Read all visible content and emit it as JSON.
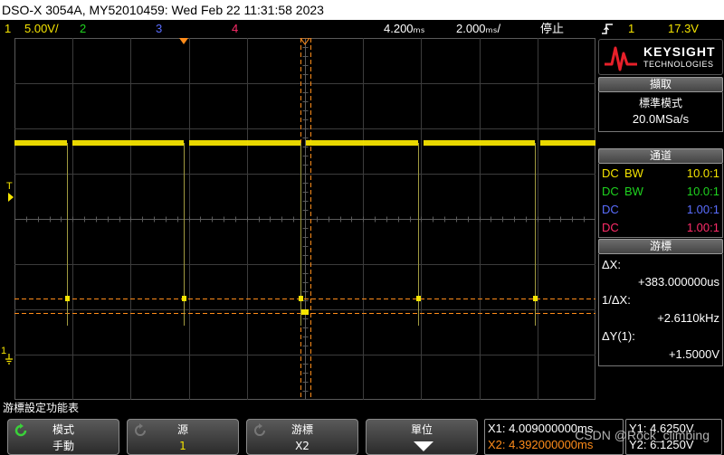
{
  "title_bar": "DSO-X 3054A, MY52010459: Wed Feb 22 11:31:58 2023",
  "status": {
    "ch1_num": "1",
    "ch1_scale": "5.00V/",
    "ch2_num": "2",
    "ch3_num": "3",
    "ch4_num": "4",
    "time_ref": "4.200ₘₛ",
    "time_scale": "2.000ₘₛ/",
    "run_state": "停止",
    "trigger_icon": "trigger-rising-edge-icon",
    "trigger_source": "1",
    "trigger_level": "17.3V"
  },
  "colors": {
    "ch1": "#f5e400",
    "ch2": "#1fd31f",
    "ch3": "#5a6dff",
    "ch4": "#ff2c6a",
    "cursor": "#ff8c1a"
  },
  "markers": {
    "trigger_level": "T",
    "ch1_ground": "1"
  },
  "panel": {
    "logo_line1": "KEYSIGHT",
    "logo_line2": "TECHNOLOGIES",
    "acq_header": "擷取",
    "acq_mode": "標準模式",
    "acq_rate": "20.0MSa/s",
    "chan_header": "通道",
    "channels": [
      {
        "coupling": "DC",
        "bw": "BW",
        "probe": "10.0:1",
        "color": "#f5e400"
      },
      {
        "coupling": "DC",
        "bw": "BW",
        "probe": "10.0:1",
        "color": "#1fd31f"
      },
      {
        "coupling": "DC",
        "bw": "",
        "probe": "1.00:1",
        "color": "#5a6dff"
      },
      {
        "coupling": "DC",
        "bw": "",
        "probe": "1.00:1",
        "color": "#ff2c6a"
      }
    ],
    "cursor_header": "游標",
    "dx_label": "ΔX:",
    "dx_value": "+383.000000us",
    "inv_dx_label": "1/ΔX:",
    "inv_dx_value": "+2.6110kHz",
    "dy_label": "ΔY(1):",
    "dy_value": "+1.5000V"
  },
  "softkey_menu_title": "游標設定功能表",
  "softkeys": {
    "mode_title": "模式",
    "mode_value": "手動",
    "source_title": "源",
    "source_value": "1",
    "cursors_title": "游標",
    "cursors_value": "X2",
    "units_title": "單位"
  },
  "cursor_readout": {
    "x1": "X1: 4.009000000ms",
    "x2": "X2: 4.392000000ms",
    "y1": "Y1: 4.6250V",
    "y2": "Y2: 6.1250V"
  },
  "watermark": "CSDN @Rock_climbing"
}
